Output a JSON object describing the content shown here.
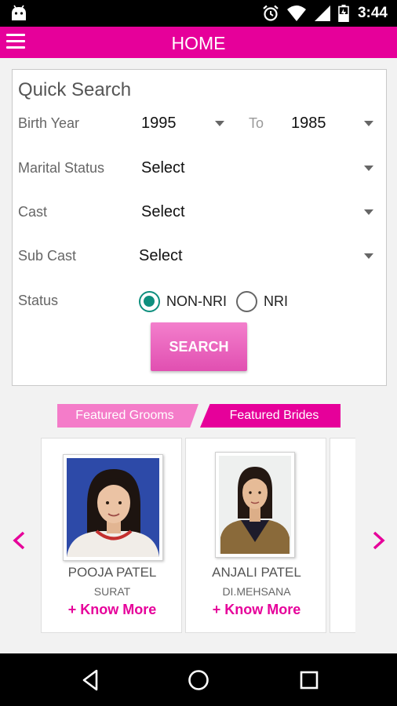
{
  "status_bar": {
    "time": "3:44"
  },
  "app_bar": {
    "title": "HOME"
  },
  "quick_search": {
    "title": "Quick Search",
    "birth_year": {
      "label": "Birth Year",
      "from": "1995",
      "to_label": "To",
      "to": "1985"
    },
    "marital_status": {
      "label": "Marital Status",
      "value": "Select"
    },
    "cast": {
      "label": "Cast",
      "value": "Select"
    },
    "sub_cast": {
      "label": "Sub Cast",
      "value": "Select"
    },
    "status": {
      "label": "Status",
      "options": [
        "NON-NRI",
        "NRI"
      ],
      "selected": "NON-NRI"
    },
    "search_label": "SEARCH"
  },
  "tabs": {
    "grooms": "Featured Grooms",
    "brides": "Featured Brides"
  },
  "profiles": [
    {
      "name": "POOJA PATEL",
      "city": "SURAT",
      "link": "+ Know More"
    },
    {
      "name": "ANJALI PATEL",
      "city": "DI.MEHSANA",
      "link": "+ Know More"
    }
  ],
  "colors": {
    "accent": "#e6009a",
    "tab_inactive": "#f47cc9",
    "radio": "#0e8f7e",
    "button": "#e14fb1"
  }
}
